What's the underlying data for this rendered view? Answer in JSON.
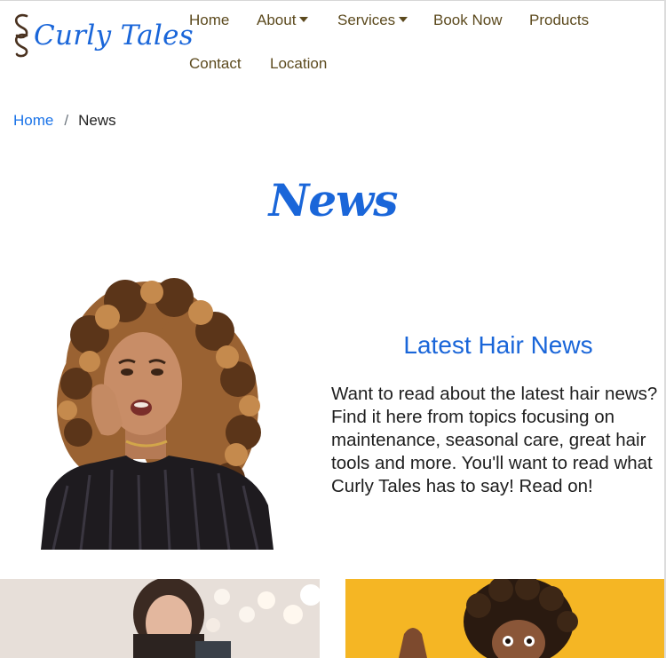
{
  "brand": {
    "name": "Curly Tales"
  },
  "nav": {
    "items": [
      {
        "label": "Home"
      },
      {
        "label": "About"
      },
      {
        "label": "Services"
      },
      {
        "label": "Book Now"
      },
      {
        "label": "Products"
      },
      {
        "label": "Contact"
      },
      {
        "label": "Location"
      }
    ]
  },
  "breadcrumb": {
    "home": "Home",
    "separator": "/",
    "current": "News"
  },
  "page": {
    "title": "News"
  },
  "intro": {
    "heading": "Latest Hair News",
    "body": "Want to read about the latest hair news? Find it here from topics focusing on maintenance, seasonal care, great hair tools and more. You'll want to read what Curly Tales has to say! Read on!"
  },
  "colors": {
    "brand_blue": "#1a66d9",
    "nav_text": "#5c4a1e",
    "link_blue": "#1a73e8",
    "card_right_bg": "#f5b624"
  },
  "icons": {
    "logo_mark": "curl-logo-icon",
    "dropdown": "caret-down-icon"
  }
}
